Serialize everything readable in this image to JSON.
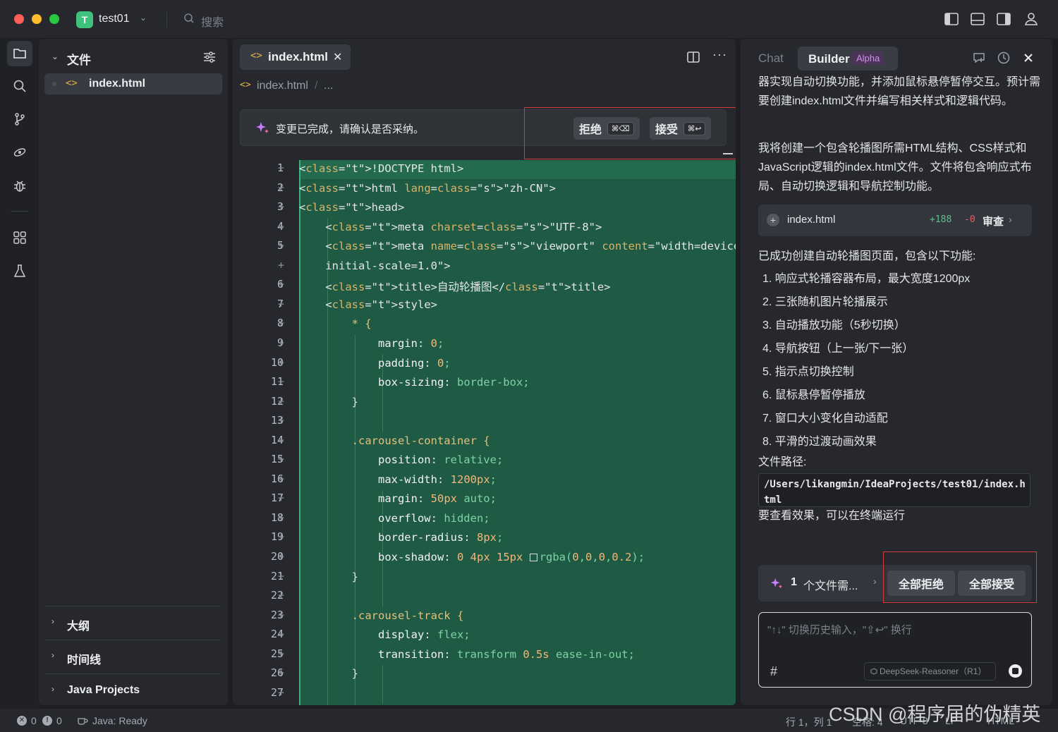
{
  "titlebar": {
    "project_badge": "T",
    "project_name": "test01",
    "search_placeholder": "搜索"
  },
  "explorer": {
    "header": "文件",
    "file_code_glyph": "<>",
    "file_name": "index.html",
    "sections": [
      "大纲",
      "时间线",
      "Java Projects"
    ]
  },
  "editor": {
    "tab_code_glyph": "<>",
    "tab_name": "index.html",
    "tab_close": "✕",
    "more": "···",
    "breadcrumb_code_glyph": "<>",
    "breadcrumb_file": "index.html",
    "breadcrumb_sep": "/",
    "breadcrumb_more": "...",
    "banner_message": "变更已完成，请确认是否采纳。",
    "reject_label": "拒绝",
    "reject_shortcut": "⌘⌫",
    "accept_label": "接受",
    "accept_shortcut": "⌘↩",
    "line_numbers": [
      "1",
      "2",
      "3",
      "4",
      "5",
      "",
      "6",
      "7",
      "8",
      "9",
      "10",
      "11",
      "12",
      "13",
      "14",
      "15",
      "16",
      "17",
      "18",
      "19",
      "20",
      "21",
      "22",
      "23",
      "24",
      "25",
      "26",
      "27"
    ],
    "code_lines": [
      "<!DOCTYPE html>",
      "<html lang=\"zh-CN\">",
      "<head>",
      "    <meta charset=\"UTF-8\">",
      "    <meta name=\"viewport\" content=\"width=device-width,",
      "    initial-scale=1.0\">",
      "    <title>自动轮播图</title>",
      "    <style>",
      "        * {",
      "            margin: 0;",
      "            padding: 0;",
      "            box-sizing: border-box;",
      "        }",
      "",
      "        .carousel-container {",
      "            position: relative;",
      "            max-width: 1200px;",
      "            margin: 50px auto;",
      "            overflow: hidden;",
      "            border-radius: 8px;",
      "            box-shadow: 0 4px 15px rgba(0,0,0,0.2);",
      "        }",
      "",
      "        .carousel-track {",
      "            display: flex;",
      "            transition: transform 0.5s ease-in-out;",
      "        }",
      ""
    ]
  },
  "panel": {
    "tab_chat": "Chat",
    "tab_builder": "Builder",
    "builder_badge": "Alpha",
    "intro_text": "器实现自动切换功能，并添加鼠标悬停暂停交互。预计需要创建index.html文件并编写相关样式和逻辑代码。",
    "plan_text": "我将创建一个包含轮播图所需HTML结构、CSS样式和JavaScript逻辑的index.html文件。文件将包含响应式布局、自动切换逻辑和导航控制功能。",
    "file_card": {
      "plus": "+",
      "name": "index.html",
      "added": "+188",
      "removed": "-0",
      "review": "审查",
      "chevron": "›"
    },
    "summary_title": "已成功创建自动轮播图页面，包含以下功能:",
    "features": [
      "1. 响应式轮播容器布局，最大宽度1200px",
      "2. 三张随机图片轮播展示",
      "3. 自动播放功能（5秒切换）",
      "4. 导航按钮（上一张/下一张）",
      "5. 指示点切换控制",
      "6. 鼠标悬停暂停播放",
      "7. 窗口大小变化自动适配",
      "8. 平滑的过渡动画效果"
    ],
    "path_label": "文件路径:",
    "path_value": "/Users/likangmin/IdeaProjects/test01/index.html",
    "view_hint": "要查看效果，可以在终端运行",
    "pending_count": "1",
    "pending_text": "个文件需...",
    "pending_chevron": "›",
    "reject_all": "全部拒绝",
    "accept_all": "全部接受",
    "input_placeholder": "\"↑↓\" 切换历史输入，\"⇧↩\" 换行",
    "hash": "#",
    "model": "DeepSeek-Reasoner（R1）"
  },
  "statusbar": {
    "errors": "0",
    "warnings": "0",
    "java_status": "Java: Ready",
    "position": "行 1，列 1",
    "indent": "空格: 4",
    "encoding": "UTF-8",
    "eol": "LF",
    "language": "HTML"
  },
  "watermark": "CSDN @程序届的伪精英",
  "colors": {
    "accent_green": "#3ec27e",
    "diff_bg": "#1f5a44",
    "highlight_red": "#d43b3b"
  }
}
